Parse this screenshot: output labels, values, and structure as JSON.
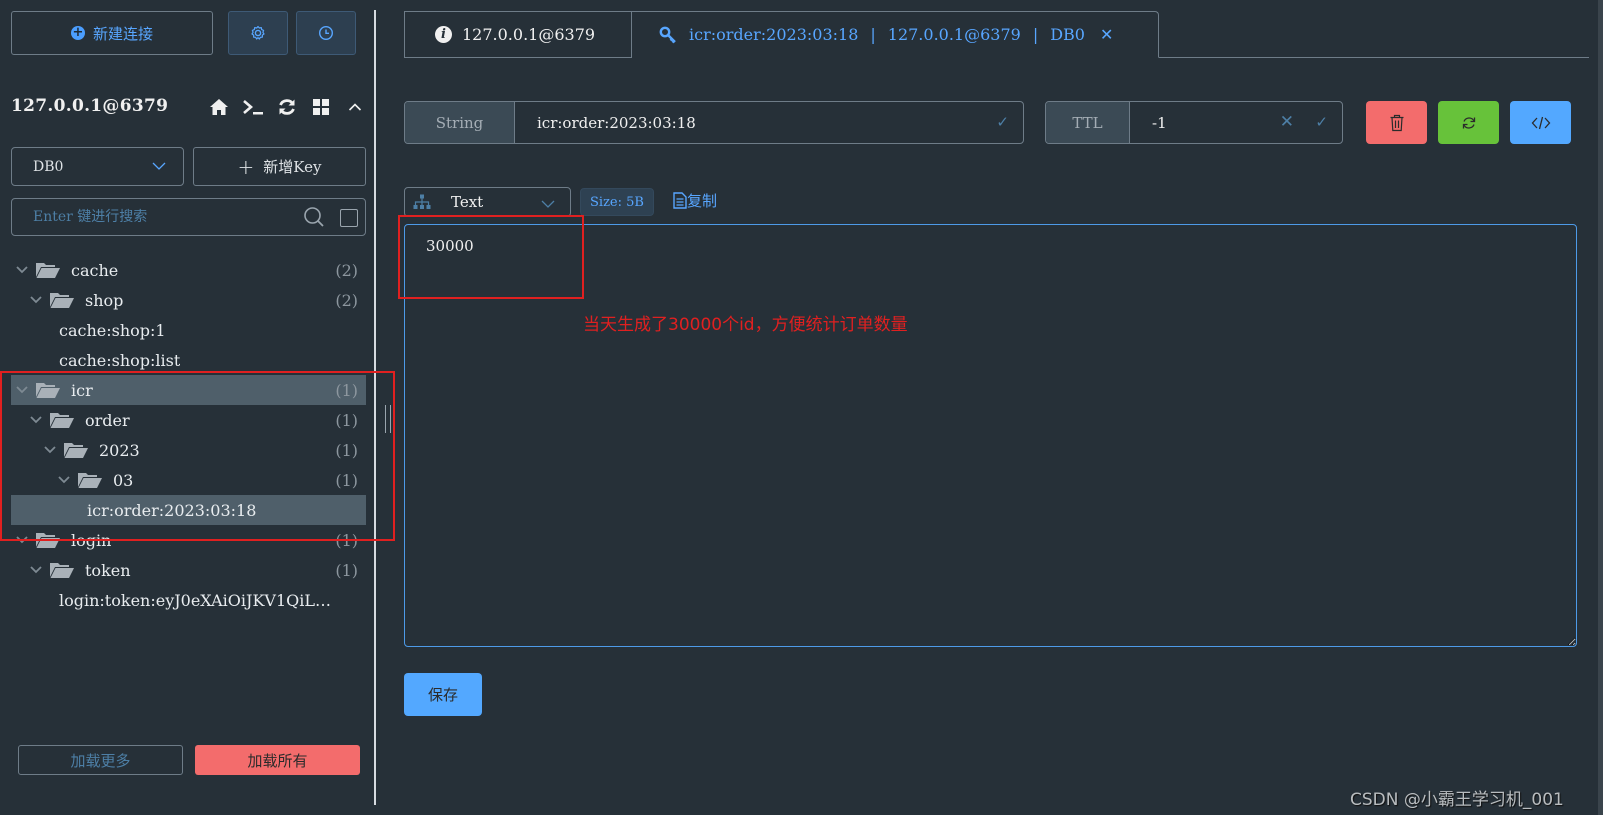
{
  "sidebar": {
    "new_connection_label": "新建连接",
    "connection_title": "127.0.0.1@6379",
    "db_select": {
      "selected": "DB0"
    },
    "new_key_label": "新增Key",
    "search": {
      "placeholder": "Enter 键进行搜索",
      "value": ""
    },
    "tree": [
      {
        "type": "folder",
        "level": 0,
        "label": "cache",
        "count": "(2)",
        "selected": false
      },
      {
        "type": "folder",
        "level": 1,
        "label": "shop",
        "count": "(2)",
        "selected": false
      },
      {
        "type": "key",
        "level": 2,
        "label": "cache:shop:1",
        "selected": false
      },
      {
        "type": "key",
        "level": 2,
        "label": "cache:shop:list",
        "selected": false
      },
      {
        "type": "folder",
        "level": 0,
        "label": "icr",
        "count": "(1)",
        "selected": true
      },
      {
        "type": "folder",
        "level": 1,
        "label": "order",
        "count": "(1)",
        "selected": false
      },
      {
        "type": "folder",
        "level": 2,
        "label": "2023",
        "count": "(1)",
        "selected": false
      },
      {
        "type": "folder",
        "level": 3,
        "label": "03",
        "count": "(1)",
        "selected": false
      },
      {
        "type": "key",
        "level": 4,
        "label": "icr:order:2023:03:18",
        "selected": true
      },
      {
        "type": "folder",
        "level": 0,
        "label": "login",
        "count": "(1)",
        "selected": false
      },
      {
        "type": "folder",
        "level": 1,
        "label": "token",
        "count": "(1)",
        "selected": false
      },
      {
        "type": "key",
        "level": 2,
        "label": "login:token:eyJ0eXAiOiJKV1QiL…",
        "selected": false
      }
    ],
    "load_more_label": "加载更多",
    "load_all_label": "加载所有"
  },
  "tabs": {
    "info_tab": {
      "label": "127.0.0.1@6379"
    },
    "key_tab": {
      "key": "icr:order:2023:03:18",
      "connection": "127.0.0.1@6379",
      "db": "DB0",
      "separator": "|"
    }
  },
  "key_detail": {
    "type_label": "String",
    "key_name": "icr:order:2023:03:18",
    "ttl_label": "TTL",
    "ttl_value": "-1",
    "format_select": {
      "selected": "Text"
    },
    "size_badge": "Size: 5B",
    "copy_label": "复制",
    "value": "30000",
    "save_label": "保存"
  },
  "annotation": {
    "text": "当天生成了30000个id，方便统计订单数量",
    "color": "#e02020"
  },
  "watermark": "CSDN @小霸王学习机_001",
  "colors": {
    "background": "#263038",
    "accent_blue": "#53a8ff",
    "danger_red": "#f36c6c",
    "success_green": "#67c23a"
  }
}
